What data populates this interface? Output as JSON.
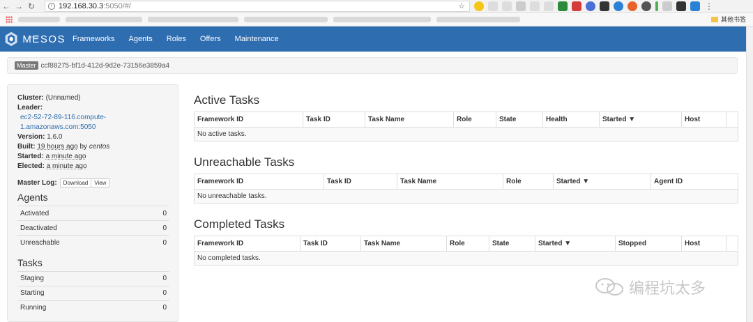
{
  "browser": {
    "url_host": "192.168.30.3",
    "url_path": ":5050/#/",
    "other_bookmarks": "其他书签"
  },
  "navbar": {
    "brand": "MESOS",
    "brand_small": "Apache",
    "items": [
      "Frameworks",
      "Agents",
      "Roles",
      "Offers",
      "Maintenance"
    ]
  },
  "master": {
    "label": "Master",
    "id": "ccf88275-bf1d-412d-9d2e-73156e3859a4"
  },
  "cluster_info": {
    "cluster_label": "Cluster:",
    "cluster_value": "(Unnamed)",
    "leader_label": "Leader:",
    "leader_value_line1": "ec2-52-72-89-116.compute-",
    "leader_value_line2": "1.amazonaws.com:5050",
    "version_label": "Version:",
    "version_value": "1.6.0",
    "built_label": "Built:",
    "built_ago": "19 hours ago",
    "built_by": "by",
    "built_user": "centos",
    "started_label": "Started:",
    "started_value": "a minute ago",
    "elected_label": "Elected:",
    "elected_value": "a minute ago",
    "master_log_label": "Master Log:",
    "download_label": "Download",
    "view_label": "View"
  },
  "agents": {
    "title": "Agents",
    "rows": [
      {
        "label": "Activated",
        "value": "0"
      },
      {
        "label": "Deactivated",
        "value": "0"
      },
      {
        "label": "Unreachable",
        "value": "0"
      }
    ]
  },
  "tasks_summary": {
    "title": "Tasks",
    "rows": [
      {
        "label": "Staging",
        "value": "0"
      },
      {
        "label": "Starting",
        "value": "0"
      },
      {
        "label": "Running",
        "value": "0"
      }
    ]
  },
  "active_tasks": {
    "title": "Active Tasks",
    "headers": [
      "Framework ID",
      "Task ID",
      "Task Name",
      "Role",
      "State",
      "Health",
      "Started ▼",
      "Host",
      ""
    ],
    "empty": "No active tasks."
  },
  "unreachable_tasks": {
    "title": "Unreachable Tasks",
    "headers": [
      "Framework ID",
      "Task ID",
      "Task Name",
      "Role",
      "Started ▼",
      "Agent ID"
    ],
    "empty": "No unreachable tasks."
  },
  "completed_tasks": {
    "title": "Completed Tasks",
    "headers": [
      "Framework ID",
      "Task ID",
      "Task Name",
      "Role",
      "State",
      "Started ▼",
      "Stopped",
      "Host",
      ""
    ],
    "empty": "No completed tasks."
  },
  "watermark": "编程坑太多"
}
